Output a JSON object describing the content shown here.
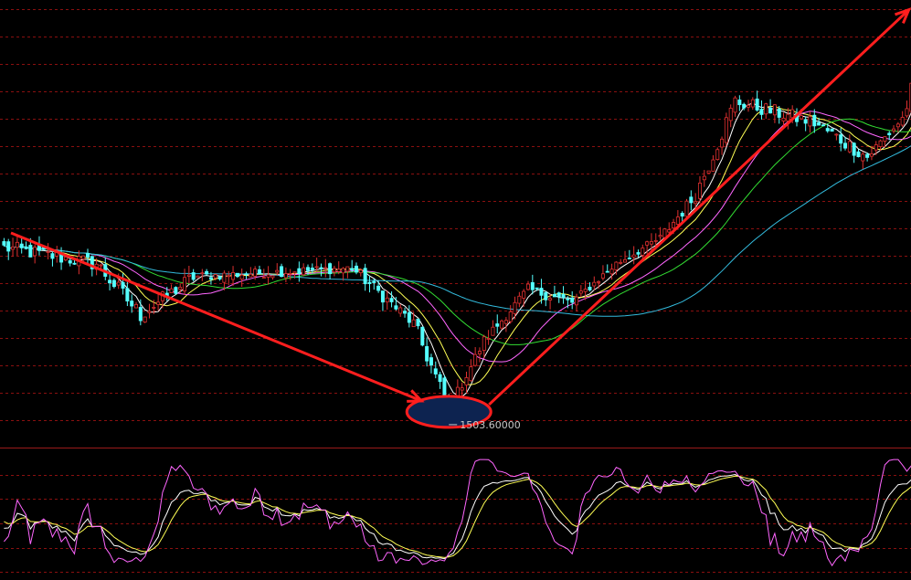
{
  "chart_data": [
    {
      "type": "candlestick",
      "panel": "price",
      "grid": true,
      "background": "#000000",
      "colors": {
        "up": "#e03030",
        "down": "#54ffff",
        "grid": "#8a1010",
        "annotation": "#ff1e1e",
        "ellipse_fill": "#0d2350",
        "ma": [
          "#ffffff",
          "#ffff55",
          "#ff66ff",
          "#33dd33",
          "#33bbdd"
        ]
      },
      "moving_average_periods": [
        5,
        10,
        20,
        30,
        60
      ],
      "low_marker": {
        "label": "1503.60000",
        "value": 1503.6
      },
      "segments": [
        {
          "from": 1920,
          "to": 1880,
          "n": 22,
          "amp": 35
        },
        {
          "from": 1880,
          "to": 1760,
          "n": 10,
          "amp": 40
        },
        {
          "from": 1760,
          "to": 1850,
          "n": 12,
          "amp": 35
        },
        {
          "from": 1850,
          "to": 1870,
          "n": 36,
          "amp": 22
        },
        {
          "from": 1870,
          "to": 1740,
          "n": 14,
          "amp": 30
        },
        {
          "from": 1740,
          "to": 1540,
          "n": 8,
          "amp": 40
        },
        {
          "from": 1540,
          "to": 1700,
          "n": 8,
          "amp": 25
        },
        {
          "from": 1700,
          "to": 1820,
          "n": 10,
          "amp": 25
        },
        {
          "from": 1820,
          "to": 1790,
          "n": 10,
          "amp": 25
        },
        {
          "from": 1790,
          "to": 1880,
          "n": 10,
          "amp": 20
        },
        {
          "from": 1880,
          "to": 1940,
          "n": 10,
          "amp": 20
        },
        {
          "from": 1940,
          "to": 2040,
          "n": 8,
          "amp": 30
        },
        {
          "from": 2040,
          "to": 2260,
          "n": 9,
          "amp": 40
        },
        {
          "from": 2260,
          "to": 2210,
          "n": 18,
          "amp": 35
        },
        {
          "from": 2210,
          "to": 2130,
          "n": 12,
          "amp": 35
        },
        {
          "from": 2130,
          "to": 2220,
          "n": 8,
          "amp": 30
        },
        {
          "from": 2220,
          "to": 2440,
          "n": 7,
          "amp": 45
        },
        {
          "from": 2440,
          "to": 2220,
          "n": 6,
          "amp": 45
        }
      ],
      "ylim": [
        1450,
        2480
      ]
    },
    {
      "type": "line",
      "panel": "indicator",
      "grid": true,
      "series": [
        {
          "color": "#ffffff"
        },
        {
          "color": "#ffff55"
        },
        {
          "color": "#ff66ff"
        }
      ],
      "ylim": [
        -15,
        115
      ]
    }
  ],
  "annotations": {
    "downtrend_arrow": true,
    "uptrend_arrow": true,
    "low_ellipse": true,
    "high_ellipse": true
  }
}
